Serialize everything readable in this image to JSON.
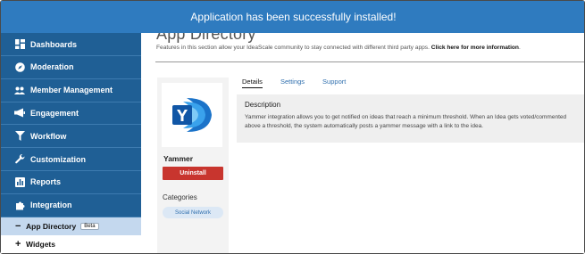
{
  "banner": {
    "text": "Application has been successfully installed!"
  },
  "colors": {
    "banner": "#2f7bbf",
    "sidebar": "#1f5f95",
    "uninstall": "#c8352e",
    "active_sub": "#c4d8ee"
  },
  "sidebar": {
    "items": [
      {
        "label": "Dashboards",
        "icon": "dashboard-icon"
      },
      {
        "label": "Moderation",
        "icon": "compass-icon"
      },
      {
        "label": "Member Management",
        "icon": "users-icon"
      },
      {
        "label": "Engagement",
        "icon": "megaphone-icon"
      },
      {
        "label": "Workflow",
        "icon": "filter-icon"
      },
      {
        "label": "Customization",
        "icon": "wrench-icon"
      },
      {
        "label": "Reports",
        "icon": "chart-icon"
      },
      {
        "label": "Integration",
        "icon": "puzzle-icon"
      }
    ],
    "sub_items": [
      {
        "label": "App Directory",
        "badge": "Beta",
        "sign": "−"
      },
      {
        "label": "Widgets",
        "sign": "+"
      }
    ]
  },
  "main": {
    "title": "App Directory",
    "intro_text": "Features in this section allow your IdeaScale community to stay connected with different third party apps.",
    "intro_link": "Click here for more information",
    "intro_suffix": "."
  },
  "app_card": {
    "name": "Yammer",
    "uninstall_label": "Uninstall",
    "categories_label": "Categories",
    "category": "Social Network"
  },
  "tabs": [
    {
      "label": "Details"
    },
    {
      "label": "Settings"
    },
    {
      "label": "Support"
    }
  ],
  "description": {
    "heading": "Description",
    "body": "Yammer integration allows you to get notified on ideas that reach a minimum threshold. When an Idea gets voted/commented above a threshold, the system automatically posts a yammer message with a link to the idea."
  }
}
